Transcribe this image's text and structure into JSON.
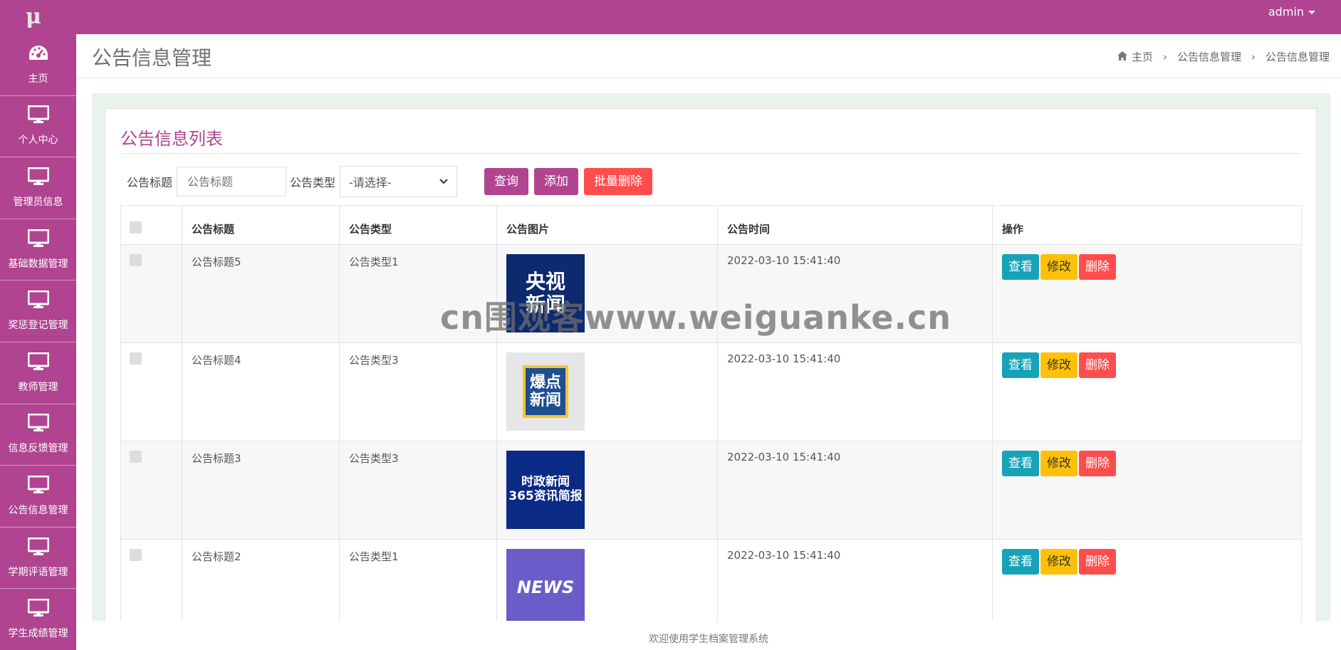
{
  "app": {
    "logo": "μ",
    "user": "admin"
  },
  "sidebar": {
    "items": [
      {
        "label": "主页",
        "icon": "dashboard-icon"
      },
      {
        "label": "个人中心",
        "icon": "monitor-icon"
      },
      {
        "label": "管理员信息",
        "icon": "monitor-icon"
      },
      {
        "label": "基础数据管理",
        "icon": "monitor-icon"
      },
      {
        "label": "奖惩登记管理",
        "icon": "monitor-icon"
      },
      {
        "label": "教师管理",
        "icon": "monitor-icon"
      },
      {
        "label": "信息反馈管理",
        "icon": "monitor-icon"
      },
      {
        "label": "公告信息管理",
        "icon": "monitor-icon"
      },
      {
        "label": "学期评语管理",
        "icon": "monitor-icon"
      },
      {
        "label": "学生成绩管理",
        "icon": "monitor-icon"
      }
    ]
  },
  "header": {
    "title": "公告信息管理",
    "breadcrumb": [
      "主页",
      "公告信息管理",
      "公告信息管理"
    ]
  },
  "card": {
    "title": "公告信息列表"
  },
  "search": {
    "title_label": "公告标题",
    "title_placeholder": "公告标题",
    "type_label": "公告类型",
    "type_value": "-请选择-",
    "query_button": "查询",
    "add_button": "添加",
    "batch_delete_button": "批量删除"
  },
  "table": {
    "columns": [
      "",
      "公告标题",
      "公告类型",
      "公告图片",
      "公告时间",
      "操作"
    ],
    "rows": [
      {
        "title": "公告标题5",
        "type": "公告类型1",
        "image_text": "央视\n新闻",
        "time": "2022-03-10 15:41:40"
      },
      {
        "title": "公告标题4",
        "type": "公告类型3",
        "image_text": "爆点\n新闻",
        "time": "2022-03-10 15:41:40"
      },
      {
        "title": "公告标题3",
        "type": "公告类型3",
        "image_text": "时政新闻\n365资讯简报",
        "time": "2022-03-10 15:41:40"
      },
      {
        "title": "公告标题2",
        "type": "公告类型1",
        "image_text": "NEWS",
        "time": "2022-03-10 15:41:40"
      }
    ],
    "actions": {
      "view": "查看",
      "edit": "修改",
      "delete": "删除"
    }
  },
  "footer": {
    "text": "欢迎使用学生档案管理系统"
  },
  "watermark": "cn围观客www.weiguanke.cn",
  "colors": {
    "brand": "#b04490",
    "danger": "#ff4d4d",
    "info": "#17a2b8",
    "warning": "#ffc107"
  }
}
